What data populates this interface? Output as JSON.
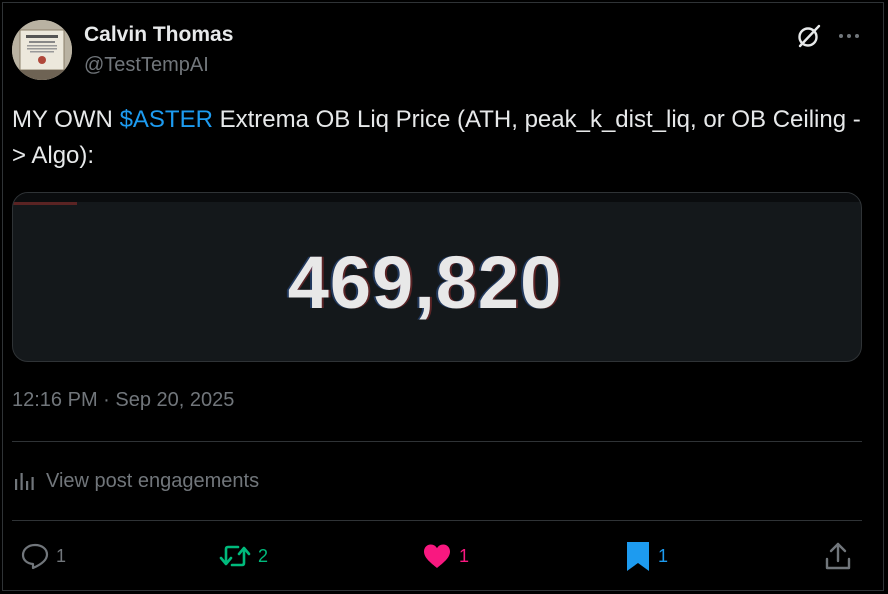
{
  "author": {
    "name": "Calvin Thomas",
    "handle": "@TestTempAI"
  },
  "post": {
    "text_prefix": "MY OWN ",
    "cashtag": "$ASTER",
    "text_suffix": " Extrema OB Liq Price (ATH, peak_k_dist_liq, or OB Ceiling -> Algo):",
    "media_value": "469,820",
    "timestamp": "12:16 PM · Sep 20, 2025"
  },
  "engagements_label": "View post engagements",
  "actions": {
    "replies": "1",
    "reposts": "2",
    "likes": "1",
    "bookmarks": "1"
  },
  "colors": {
    "background": "#000000",
    "text": "#e7e9ea",
    "secondary": "#71767b",
    "accent": "#1d9bf0",
    "repost_active": "#00ba7c",
    "like_active": "#f91880",
    "bookmark_active": "#1d9bf0"
  },
  "icons": [
    "grok-icon",
    "more-icon",
    "analytics-icon",
    "reply-icon",
    "repost-icon",
    "like-icon",
    "bookmark-icon",
    "share-icon"
  ]
}
